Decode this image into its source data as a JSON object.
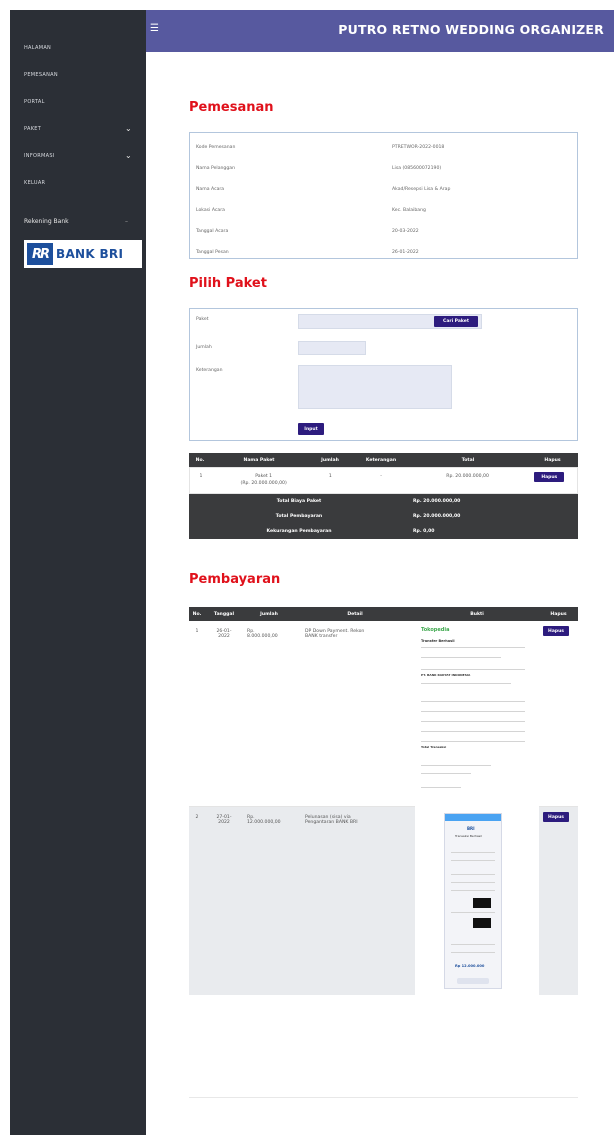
{
  "sidebar": {
    "items": [
      {
        "label": "HALAMAN"
      },
      {
        "label": "PEMESANAN"
      },
      {
        "label": "PORTAL"
      },
      {
        "label": "PAKET"
      },
      {
        "label": "INFORMASI"
      },
      {
        "label": "KELUAR"
      }
    ],
    "bank_label": "Rekening Bank",
    "bank_logo_text": "BANK BRI",
    "bank_logo_mark": "RR"
  },
  "topbar": {
    "menu_icon": "hamburger-icon",
    "brand": "PUTRO RETNO WEDDING ORGANIZER"
  },
  "order": {
    "title": "Pemesanan",
    "rows": [
      {
        "label": "Kode Pemesanan",
        "value": "PTRETWOR-2022-0018"
      },
      {
        "label": "Nama Pelanggan",
        "value": "Lisa (085600072190)"
      },
      {
        "label": "Nama Acara",
        "value": "Akad/Resepsi Lisa & Arap"
      },
      {
        "label": "Lokasi Acara",
        "value": "Kec. Balaibang"
      },
      {
        "label": "Tanggal Acara",
        "value": "20-03-2022"
      },
      {
        "label": "Tanggal Pesan",
        "value": "26-01-2022"
      }
    ]
  },
  "package_form": {
    "title": "Pilih Paket",
    "paket_label": "Paket",
    "find_button": "Cari Paket",
    "jumlah_label": "Jumlah",
    "keterangan_label": "Keterangan",
    "submit_button": "Input"
  },
  "package_table": {
    "headers": [
      "No.",
      "Nama Paket",
      "Jumlah",
      "Keterangan",
      "Total",
      "Hapus"
    ],
    "rows": [
      {
        "no": "1",
        "name": "Paket 1",
        "price": "(Rp. 20.000.000,00)",
        "qty": "1",
        "note": "-",
        "total": "Rp. 20.000.000,00",
        "action": "Hapus"
      }
    ],
    "totals": [
      {
        "label": "Total Biaya Paket",
        "value": "Rp. 20.000.000,00"
      },
      {
        "label": "Total Pembayaran",
        "value": "Rp. 20.000.000,00"
      },
      {
        "label": "Kekurangan Pembayaran",
        "value": "Rp. 0,00"
      }
    ]
  },
  "payments": {
    "title": "Pembayaran",
    "headers": [
      "No.",
      "Tanggal",
      "Jumlah",
      "Detail",
      "Bukti",
      "Hapus"
    ],
    "rows": [
      {
        "no": "1",
        "date1": "26-01-",
        "date2": "2022",
        "amt1": "Rp.",
        "amt2": "8.000.000,00",
        "det1": "DP Down Payment. Rekon",
        "det2": "BANK transfer",
        "action": "Hapus",
        "proof_logo": "Tokopedia",
        "proof_title": "Transfer Berhasil",
        "proof_bank": "PT. BANK RAKYAT INDONESIA",
        "proof_total": "Total Transaksi"
      },
      {
        "no": "2",
        "date1": "27-01-",
        "date2": "2022",
        "amt1": "Rp.",
        "amt2": "12.000.000,00",
        "det1": "Pelunasan (sisa) via",
        "det2": "Pengantaran BANK BRI",
        "action": "Hapus",
        "proof_logo": "BRI",
        "proof_title": "Transaksi Berhasil",
        "proof_amount": "Rp 12.000.000"
      }
    ]
  }
}
